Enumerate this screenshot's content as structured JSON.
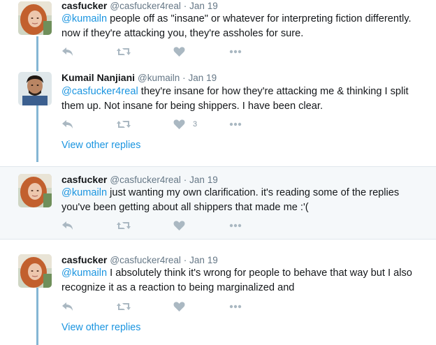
{
  "colors": {
    "link": "#1b95e0",
    "thread_line": "#84b6d4",
    "icon": "#aab8c2"
  },
  "tweets": [
    {
      "name": "casfucker",
      "handle": "@casfucker4real",
      "dot": "·",
      "time": "Jan 19",
      "mention": "@kumailn",
      "text": " people off as \"insane\" or whatever for interpreting fiction differently. now if they're attacking you, they're assholes for sure.",
      "like_count": ""
    },
    {
      "name": "Kumail Nanjiani",
      "handle": "@kumailn",
      "dot": "·",
      "time": "Jan 19",
      "mention": "@casfucker4real",
      "text": " they're insane for how they're attacking me & thinking I split them up. Not insane for being shippers. I have been clear.",
      "like_count": "3"
    },
    {
      "name": "casfucker",
      "handle": "@casfucker4real",
      "dot": "·",
      "time": "Jan 19",
      "mention": "@kumailn",
      "text": " just wanting my own clarification. it's reading some of the replies you've been getting about all shippers that made me :'(",
      "like_count": ""
    },
    {
      "name": "casfucker",
      "handle": "@casfucker4real",
      "dot": "·",
      "time": "Jan 19",
      "mention": "@kumailn",
      "text": " I absolutely think it's wrong for people to behave that way but I also recognize it as a reaction to being marginalized and",
      "like_count": ""
    }
  ],
  "view_other_replies_1": "View other replies",
  "view_other_replies_2": "View other replies",
  "icons": [
    "reply-icon",
    "retweet-icon",
    "like-icon",
    "more-icon"
  ]
}
